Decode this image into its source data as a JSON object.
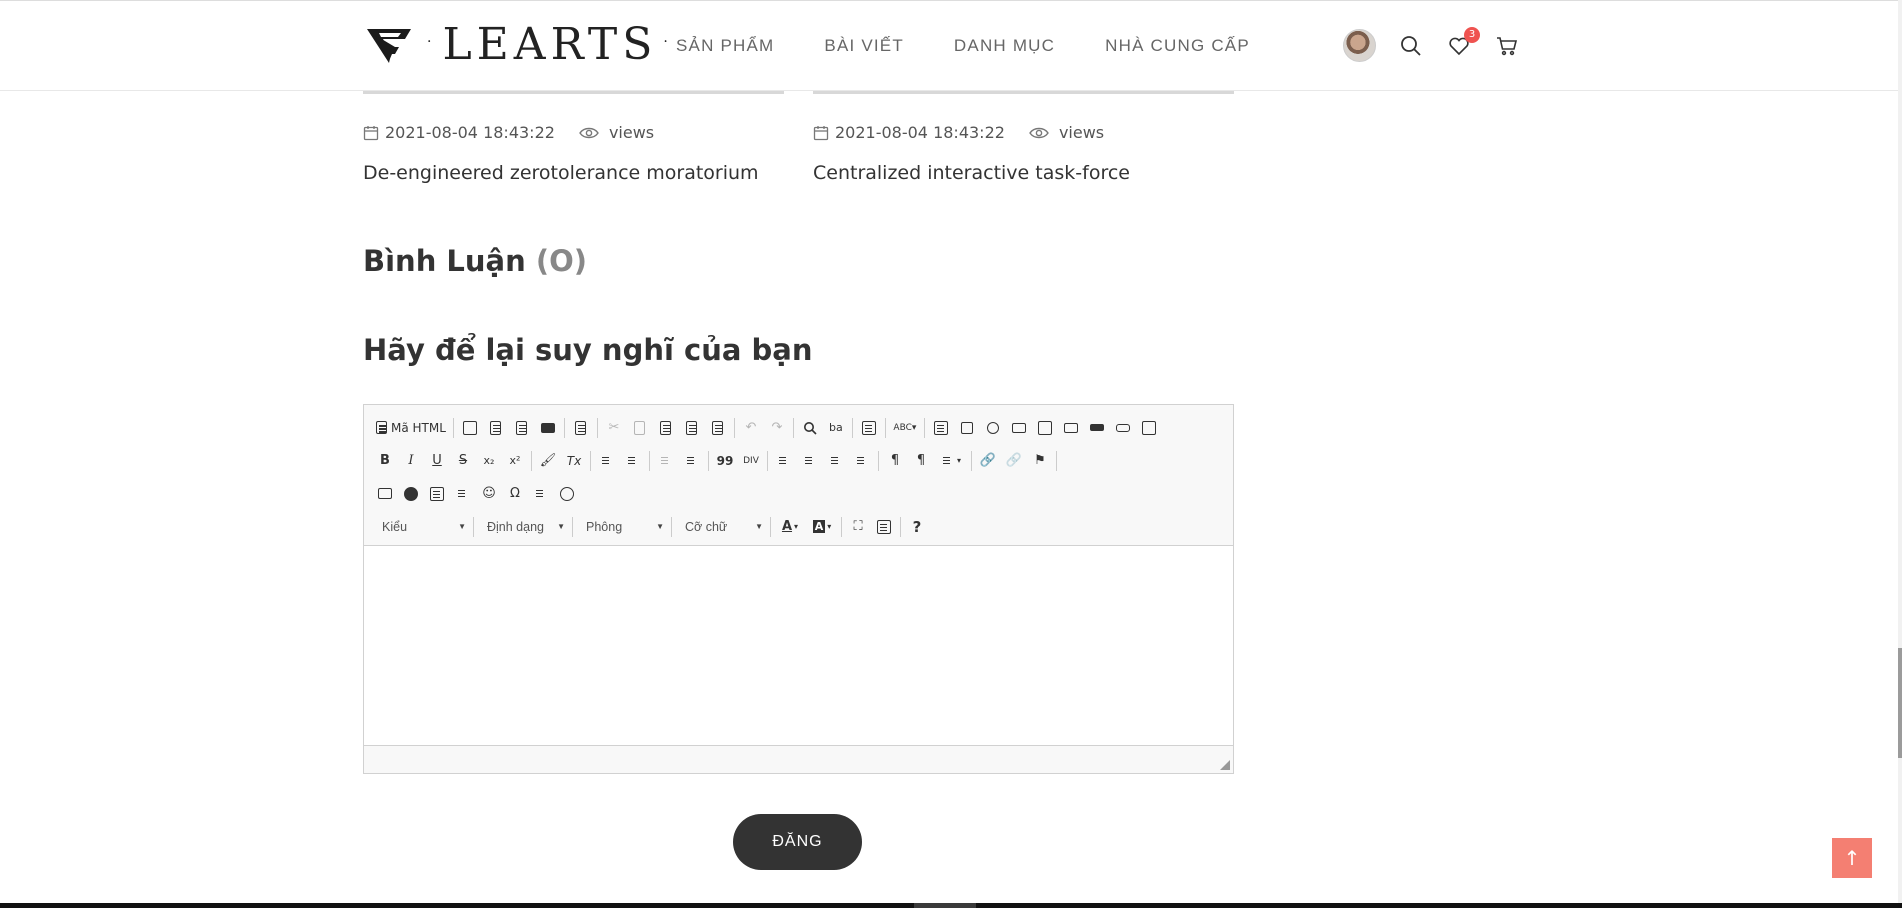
{
  "brand": {
    "name": "LEARTS",
    "dot": "·"
  },
  "nav": {
    "items": [
      {
        "label": "SẢN PHẨM"
      },
      {
        "label": "BÀI VIẾT"
      },
      {
        "label": "DANH MỤC"
      },
      {
        "label": "NHÀ CUNG CẤP"
      }
    ]
  },
  "header_icons": {
    "wishlist_count": "3"
  },
  "posts": [
    {
      "date": "2021-08-04 18:43:22",
      "views_label": "views",
      "title": "De-engineered zerotolerance moratorium"
    },
    {
      "date": "2021-08-04 18:43:22",
      "views_label": "views",
      "title": "Centralized interactive task-force"
    }
  ],
  "comments": {
    "heading": "Bình Luận",
    "count": "(O)"
  },
  "reply": {
    "heading": "Hãy để lại suy nghĩ của bạn"
  },
  "editor": {
    "source_label": "Mã HTML",
    "combos": {
      "style": "Kiểu",
      "format": "Định dạng",
      "font": "Phông",
      "size": "Cỡ chữ"
    },
    "glyphs": {
      "bold": "B",
      "italic": "I",
      "underline": "U",
      "strike": "S",
      "subscript": "x₂",
      "superscript": "x²",
      "clear": "Tx",
      "quote": "99",
      "omega": "Ω",
      "help": "?",
      "text_color": "A",
      "bg_color": "A"
    }
  },
  "submit": {
    "label": "ĐĂNG"
  },
  "back_to_top": {
    "glyph": "↑"
  },
  "colors": {
    "accent": "#f47f72",
    "badge": "#ef5350",
    "button": "#333333"
  }
}
